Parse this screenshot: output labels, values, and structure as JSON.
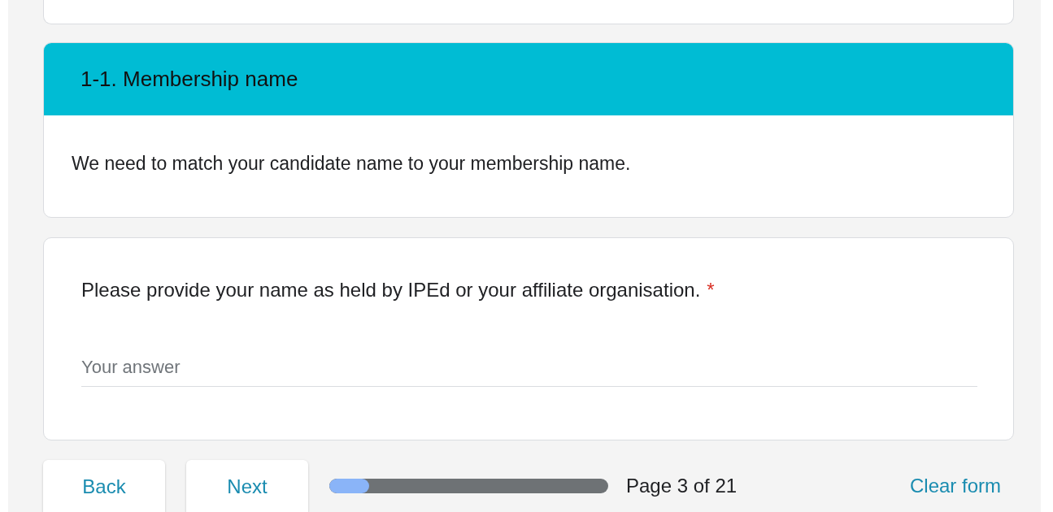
{
  "section": {
    "title": "1-1. Membership name",
    "description": "We need to match your candidate name to your membership name."
  },
  "question": {
    "text": "Please provide your name as held by IPEd or your affiliate organisation.",
    "required": true,
    "required_mark": "*",
    "placeholder": "Your answer"
  },
  "footer": {
    "buttons": [
      "Back",
      "Next"
    ],
    "progress": {
      "level": 0.143
    },
    "page_label": "Page 3 of 21",
    "clear_label": "Clear form"
  }
}
